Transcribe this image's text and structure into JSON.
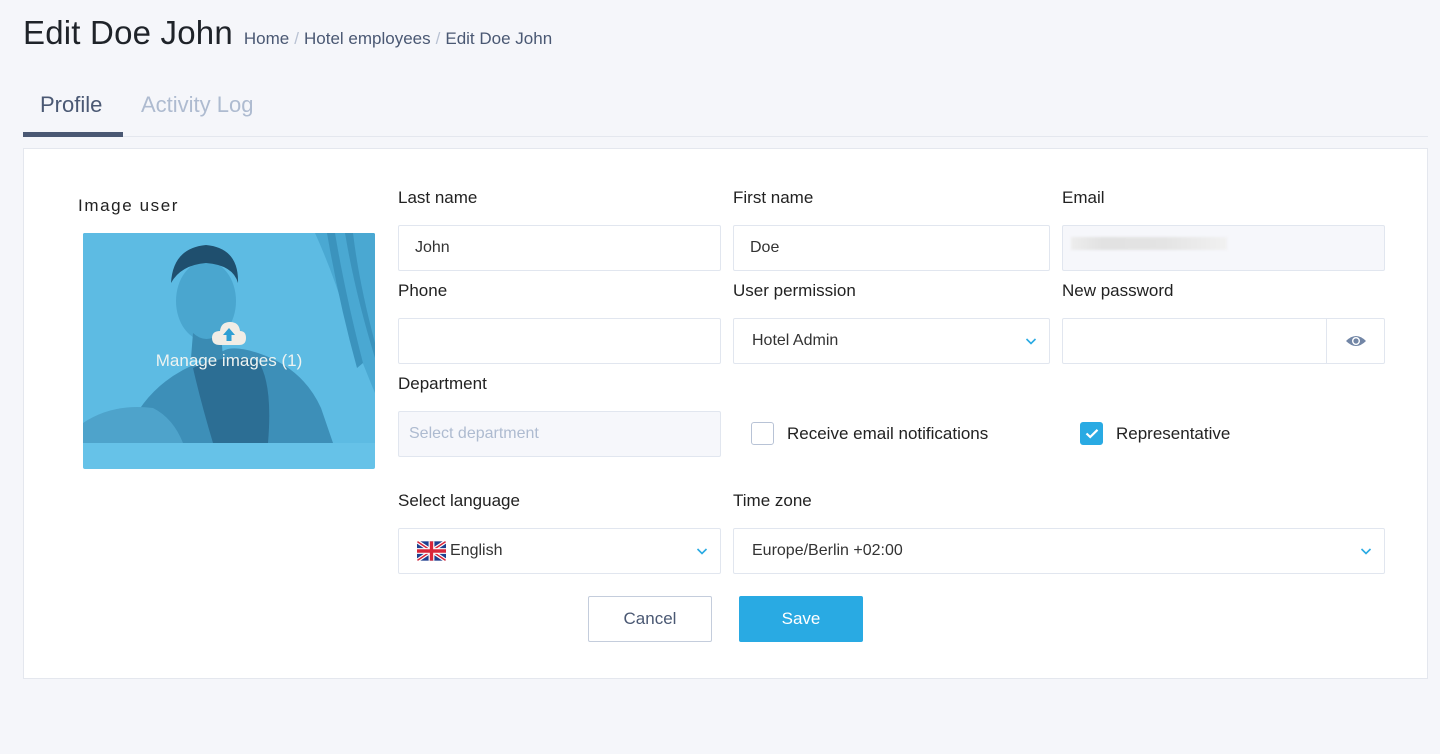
{
  "header": {
    "title": "Edit Doe John",
    "breadcrumb": [
      "Home",
      "Hotel employees",
      "Edit Doe John"
    ],
    "separator": "/"
  },
  "tabs": [
    {
      "label": "Profile",
      "active": true
    },
    {
      "label": "Activity Log",
      "active": false
    }
  ],
  "image": {
    "label": "Image user",
    "manage_text": "Manage images (1)",
    "icon": "cloud-upload-icon"
  },
  "form": {
    "last_name": {
      "label": "Last name",
      "value": "John"
    },
    "first_name": {
      "label": "First name",
      "value": "Doe"
    },
    "email": {
      "label": "Email",
      "value": "",
      "disabled": true
    },
    "phone": {
      "label": "Phone",
      "value": ""
    },
    "user_permission": {
      "label": "User permission",
      "value": "Hotel Admin"
    },
    "new_password": {
      "label": "New password",
      "value": "",
      "toggle_icon": "eye-icon"
    },
    "department": {
      "label": "Department",
      "placeholder": "Select department"
    },
    "receive_email": {
      "label": "Receive email notifications",
      "checked": false
    },
    "representative": {
      "label": "Representative",
      "checked": true
    },
    "language": {
      "label": "Select language",
      "value": "English",
      "flag": "uk-flag-icon"
    },
    "time_zone": {
      "label": "Time zone",
      "value": "Europe/Berlin +02:00"
    }
  },
  "actions": {
    "cancel_label": "Cancel",
    "save_label": "Save"
  },
  "colors": {
    "accent": "#29aae3",
    "tab_active": "#4a5873",
    "tab_inactive": "#aebbd0",
    "background": "#f5f6fa"
  }
}
